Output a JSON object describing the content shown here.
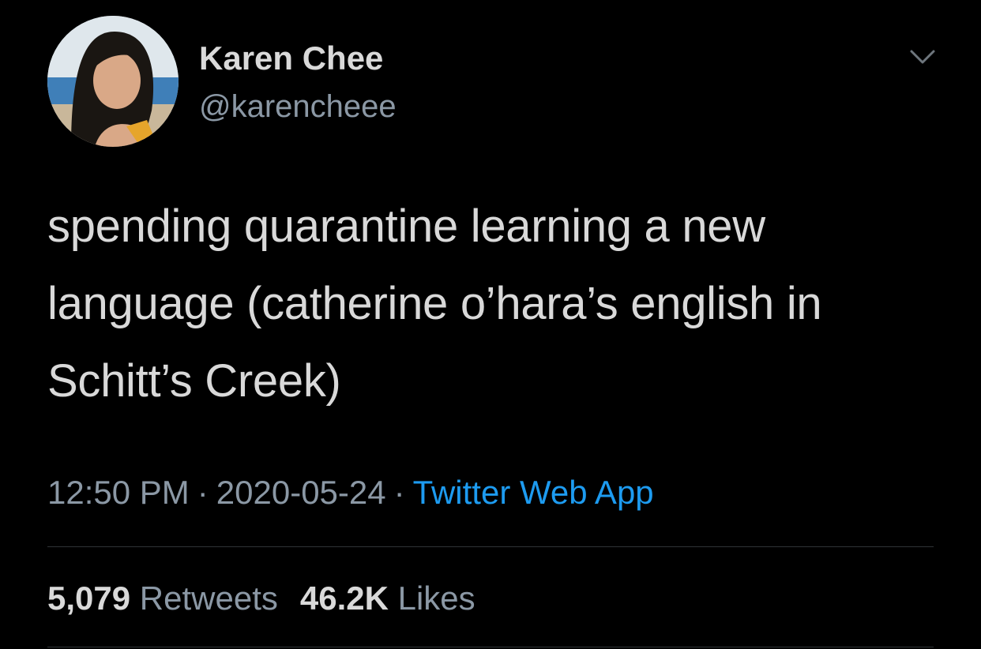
{
  "author": {
    "display_name": "Karen Chee",
    "handle": "@karencheee"
  },
  "tweet": {
    "text": "spending quarantine learning a new language (catherine o’hara’s english in Schitt’s Creek)",
    "time": "12:50 PM",
    "date": "2020-05-24",
    "separator": "·",
    "source": "Twitter Web App"
  },
  "stats": {
    "retweets_count": "5,079",
    "retweets_label": "Retweets",
    "likes_count": "46.2K",
    "likes_label": "Likes"
  },
  "icons": {
    "more": "chevron-down-icon"
  },
  "colors": {
    "background": "#000000",
    "text": "#d9d9d9",
    "secondary": "#8b98a5",
    "accent": "#1d9bf0"
  }
}
